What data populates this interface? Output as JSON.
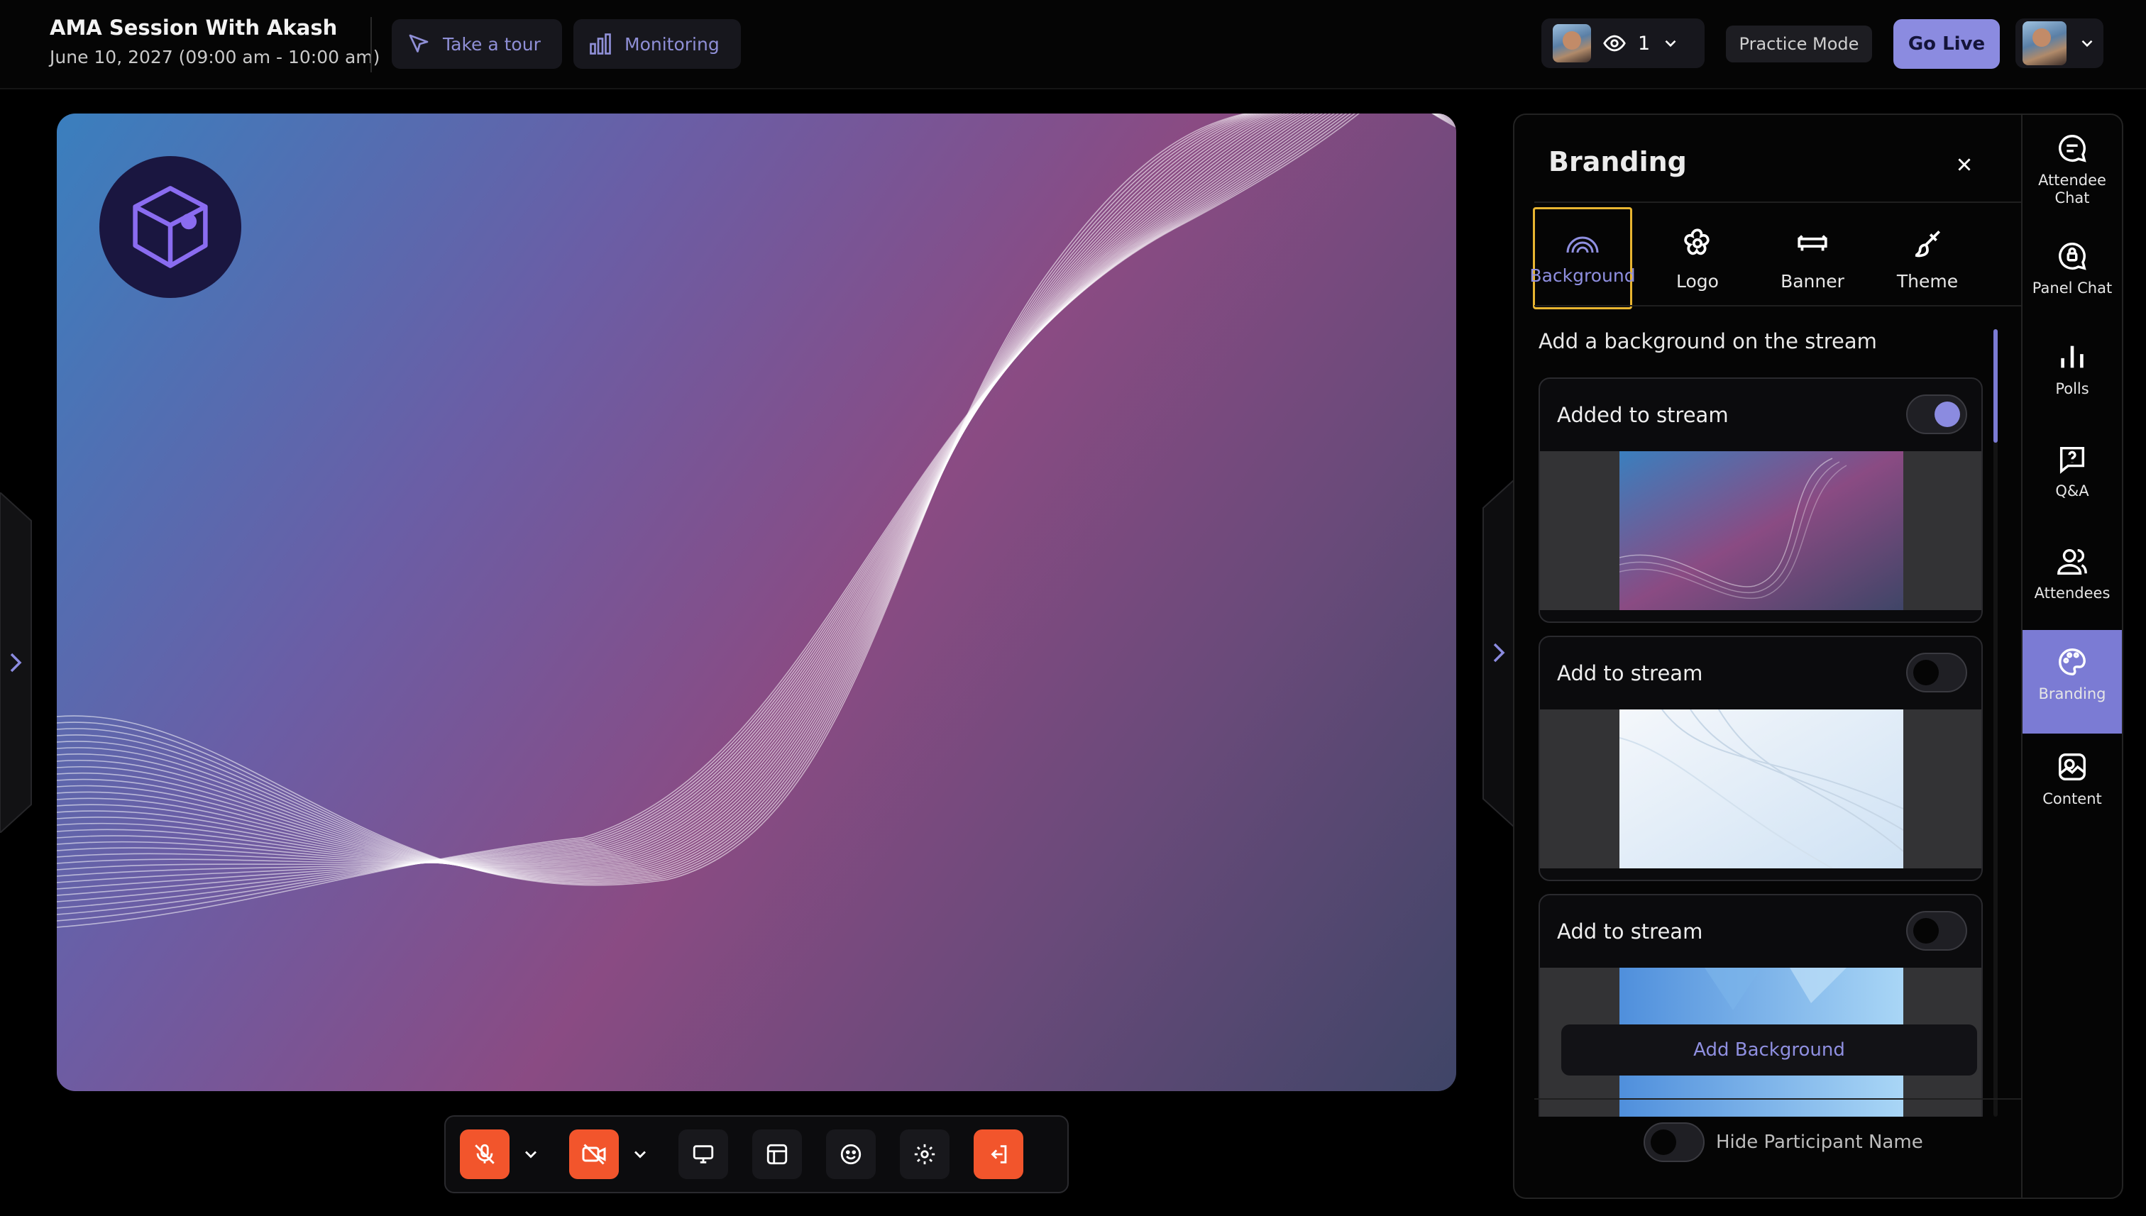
{
  "session": {
    "title": "AMA Session With Akash",
    "datetime": "June 10, 2027 (09:00 am - 10:00 am)"
  },
  "topbar": {
    "tour_label": "Take a tour",
    "monitoring_label": "Monitoring",
    "viewer_count": "1",
    "practice_label": "Practice Mode",
    "go_live_label": "Go Live"
  },
  "branding": {
    "title": "Branding",
    "tabs": [
      {
        "label": "Background",
        "icon": "rainbow-icon",
        "active": true
      },
      {
        "label": "Logo",
        "icon": "flower-icon",
        "active": false
      },
      {
        "label": "Banner",
        "icon": "banner-icon",
        "active": false
      },
      {
        "label": "Theme",
        "icon": "brush-icon",
        "active": false
      }
    ],
    "description": "Add a background on the stream",
    "cards": [
      {
        "label": "Added to stream",
        "enabled": true
      },
      {
        "label": "Add to stream",
        "enabled": false
      },
      {
        "label": "Add to stream",
        "enabled": false
      }
    ],
    "add_button": "Add Background",
    "hide_participant_label": "Hide Participant Name"
  },
  "rail": [
    {
      "label": "Attendee Chat",
      "icon": "chat-icon",
      "active": false
    },
    {
      "label": "Panel Chat",
      "icon": "lock-chat-icon",
      "active": false
    },
    {
      "label": "Polls",
      "icon": "bar-chart-icon",
      "active": false
    },
    {
      "label": "Q&A",
      "icon": "question-icon",
      "active": false
    },
    {
      "label": "Attendees",
      "icon": "people-icon",
      "active": false
    },
    {
      "label": "Branding",
      "icon": "palette-icon",
      "active": true
    },
    {
      "label": "Content",
      "icon": "content-icon",
      "active": false
    }
  ],
  "colors": {
    "accent": "#8b8be0",
    "danger": "#f2552c",
    "focus": "#e8b531"
  }
}
